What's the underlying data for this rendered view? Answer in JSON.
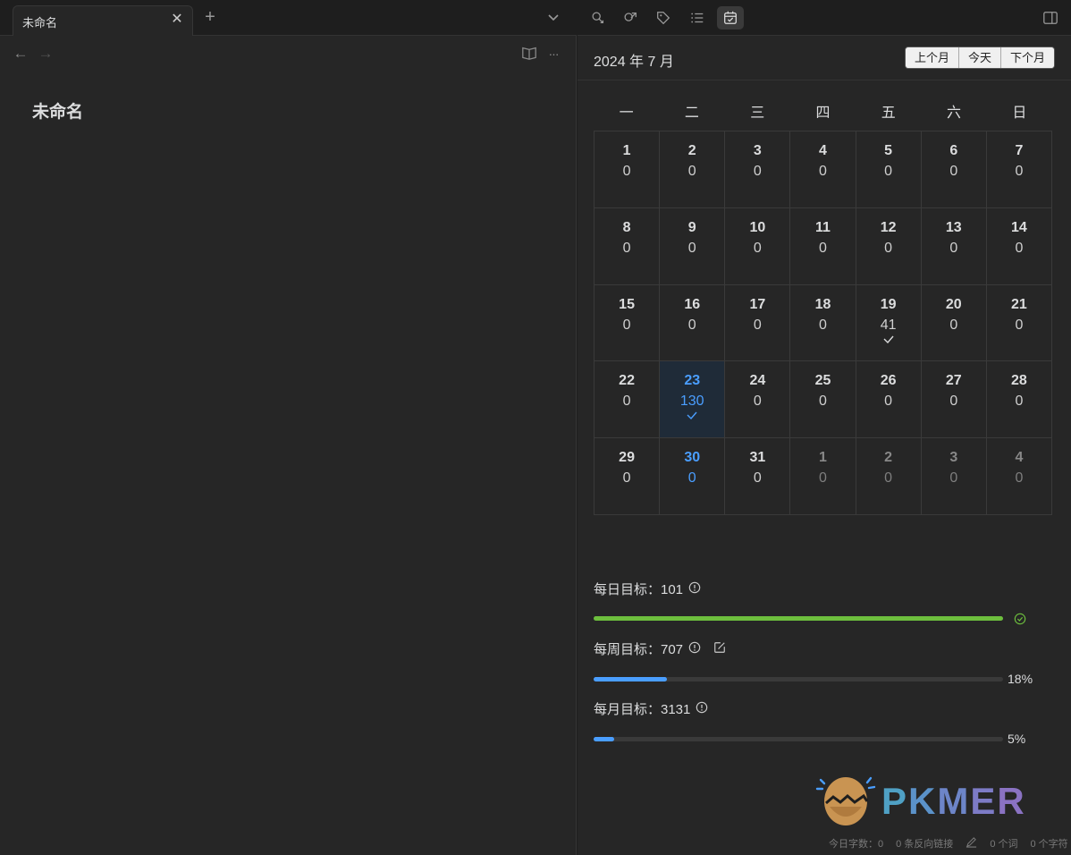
{
  "tab": {
    "title": "未命名",
    "close": "✕",
    "new": "+"
  },
  "nav": {
    "back": "←",
    "forward": "→",
    "more": "···"
  },
  "document": {
    "title": "未命名"
  },
  "toolbar": {
    "icons": [
      "backlink-icon",
      "outgoing-link-icon",
      "tags-icon",
      "outline-icon",
      "calendar-icon"
    ]
  },
  "calendar": {
    "month_title": "2024 年 7 月",
    "buttons": {
      "prev": "上个月",
      "today": "今天",
      "next": "下个月"
    },
    "weekdays": [
      "一",
      "二",
      "三",
      "四",
      "五",
      "六",
      "日"
    ],
    "cells": [
      {
        "day": "1",
        "count": "0"
      },
      {
        "day": "2",
        "count": "0"
      },
      {
        "day": "3",
        "count": "0"
      },
      {
        "day": "4",
        "count": "0"
      },
      {
        "day": "5",
        "count": "0"
      },
      {
        "day": "6",
        "count": "0"
      },
      {
        "day": "7",
        "count": "0"
      },
      {
        "day": "8",
        "count": "0"
      },
      {
        "day": "9",
        "count": "0"
      },
      {
        "day": "10",
        "count": "0"
      },
      {
        "day": "11",
        "count": "0"
      },
      {
        "day": "12",
        "count": "0"
      },
      {
        "day": "13",
        "count": "0"
      },
      {
        "day": "14",
        "count": "0"
      },
      {
        "day": "15",
        "count": "0"
      },
      {
        "day": "16",
        "count": "0"
      },
      {
        "day": "17",
        "count": "0"
      },
      {
        "day": "18",
        "count": "0"
      },
      {
        "day": "19",
        "count": "41",
        "check": true
      },
      {
        "day": "20",
        "count": "0"
      },
      {
        "day": "21",
        "count": "0"
      },
      {
        "day": "22",
        "count": "0"
      },
      {
        "day": "23",
        "count": "130",
        "check": true,
        "state": "today"
      },
      {
        "day": "24",
        "count": "0"
      },
      {
        "day": "25",
        "count": "0"
      },
      {
        "day": "26",
        "count": "0"
      },
      {
        "day": "27",
        "count": "0"
      },
      {
        "day": "28",
        "count": "0"
      },
      {
        "day": "29",
        "count": "0"
      },
      {
        "day": "30",
        "count": "0",
        "state": "blue"
      },
      {
        "day": "31",
        "count": "0"
      },
      {
        "day": "1",
        "count": "0",
        "state": "other"
      },
      {
        "day": "2",
        "count": "0",
        "state": "other"
      },
      {
        "day": "3",
        "count": "0",
        "state": "other"
      },
      {
        "day": "4",
        "count": "0",
        "state": "other"
      }
    ]
  },
  "goals": {
    "daily": {
      "label": "每日目标：101",
      "progress": 1.0,
      "color": "#6dbf3d",
      "done": true
    },
    "weekly": {
      "label": "每周目标：707",
      "progress": 0.18,
      "pct": "18%",
      "color": "#4a9eff"
    },
    "monthly": {
      "label": "每月目标：3131",
      "progress": 0.05,
      "pct": "5%",
      "color": "#4a9eff"
    }
  },
  "logo": {
    "text": "PKMER"
  },
  "status": {
    "today_words": "今日字数：0",
    "backlinks": "0 条反向链接",
    "words": "0 个词",
    "chars": "0 个字符"
  },
  "colors": {
    "accent": "#4a9eff",
    "success": "#6dbf3d"
  }
}
